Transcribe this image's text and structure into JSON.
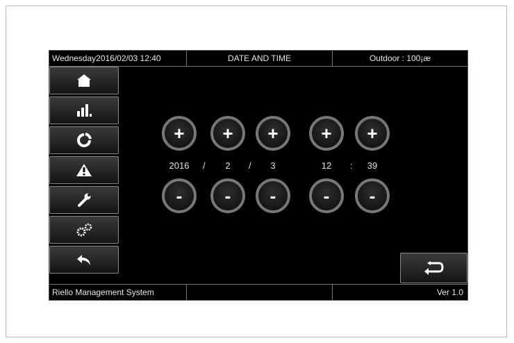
{
  "header": {
    "datetime": "Wednesday2016/02/03 12:40",
    "title": "DATE AND TIME",
    "outdoor": "Outdoor : 100¡æ"
  },
  "footer": {
    "system": "Riello Management System",
    "middle": "",
    "version": "Ver 1.0"
  },
  "sidebar": {
    "items": [
      {
        "icon": "home-icon"
      },
      {
        "icon": "bar-chart-icon"
      },
      {
        "icon": "refresh-icon"
      },
      {
        "icon": "warning-icon"
      },
      {
        "icon": "wrench-icon"
      },
      {
        "icon": "gears-icon"
      },
      {
        "icon": "back-arrow-icon"
      }
    ]
  },
  "controls": {
    "plus_label": "+",
    "minus_label": "-",
    "fields": [
      {
        "name": "year",
        "value": "2016"
      },
      {
        "name": "month",
        "value": "2"
      },
      {
        "name": "day",
        "value": "3"
      },
      {
        "name": "hour",
        "value": "12"
      },
      {
        "name": "minute",
        "value": "39"
      }
    ],
    "date_separator": "/",
    "time_separator": ":"
  },
  "return_button": {
    "icon": "return-icon"
  }
}
